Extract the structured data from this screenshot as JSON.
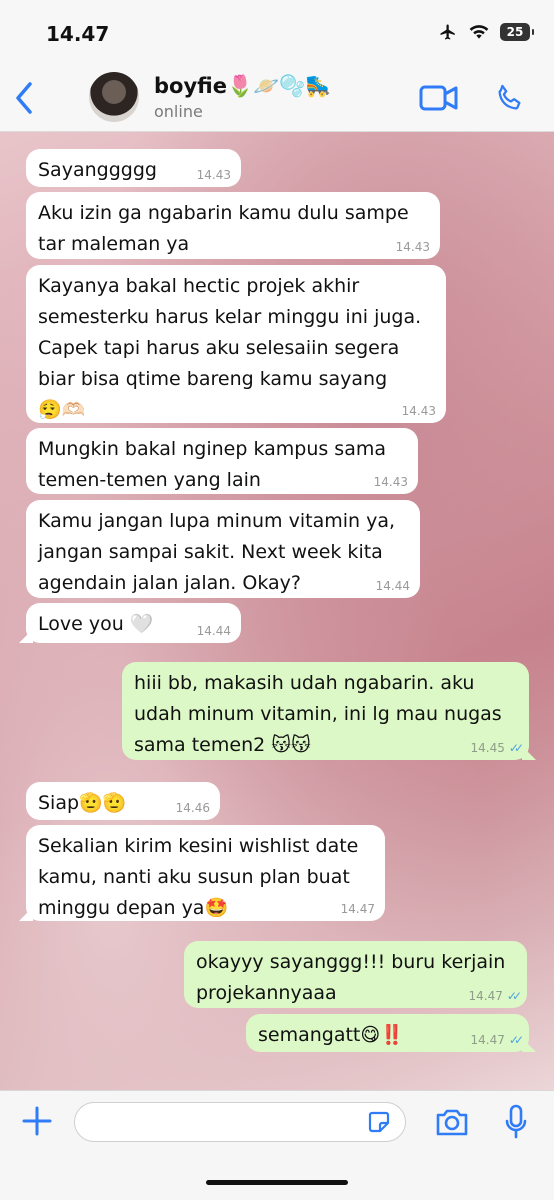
{
  "status_bar": {
    "time": "14.47",
    "battery": "25"
  },
  "header": {
    "contact_name": "boyfie",
    "contact_emoji": "🌷🪐🫧🛼",
    "contact_status": "online",
    "accent_color": "#2f7cf6"
  },
  "messages": [
    {
      "direction": "in",
      "text": "Sayanggggg",
      "time": "14.43"
    },
    {
      "direction": "in",
      "text": "Aku izin ga ngabarin kamu dulu sampe\ntar maleman ya",
      "time": "14.43"
    },
    {
      "direction": "in",
      "text": "Kayanya bakal hectic projek akhir\nsemesterku harus kelar minggu ini juga.\nCapek tapi harus aku selesaiin segera\nbiar bisa qtime bareng kamu sayang\n😮‍💨🫶🏻",
      "time": "14.43"
    },
    {
      "direction": "in",
      "text": "Mungkin bakal nginep kampus sama\ntemen-temen yang lain",
      "time": "14.43"
    },
    {
      "direction": "in",
      "text": "Kamu jangan lupa minum vitamin ya,\njangan sampai sakit. Next week kita\nagendain jalan jalan. Okay?",
      "time": "14.44"
    },
    {
      "direction": "in",
      "text": "Love you 🤍",
      "time": "14.44"
    },
    {
      "direction": "out",
      "text": "hiii bb, makasih udah ngabarin. aku\nudah minum vitamin, ini lg mau nugas\nsama temen2 😽😽",
      "time": "14.45"
    },
    {
      "direction": "in",
      "text": "Siap🫡🫡",
      "time": "14.46"
    },
    {
      "direction": "in",
      "text": "Sekalian kirim kesini wishlist date\nkamu, nanti aku susun plan buat\nminggu depan ya🤩",
      "time": "14.47"
    },
    {
      "direction": "out",
      "text": "okayyy sayanggg!!! buru kerjain\nprojekannyaaa",
      "time": "14.47"
    },
    {
      "direction": "out",
      "text": "semangatt😋‼️",
      "time": "14.47"
    }
  ],
  "composer": {
    "placeholder": ""
  },
  "icons": {
    "back": "chevron-left-icon",
    "video": "video-camera-icon",
    "call": "phone-icon",
    "plus": "plus-icon",
    "sticker": "sticker-icon",
    "camera": "camera-icon",
    "mic": "microphone-icon"
  }
}
